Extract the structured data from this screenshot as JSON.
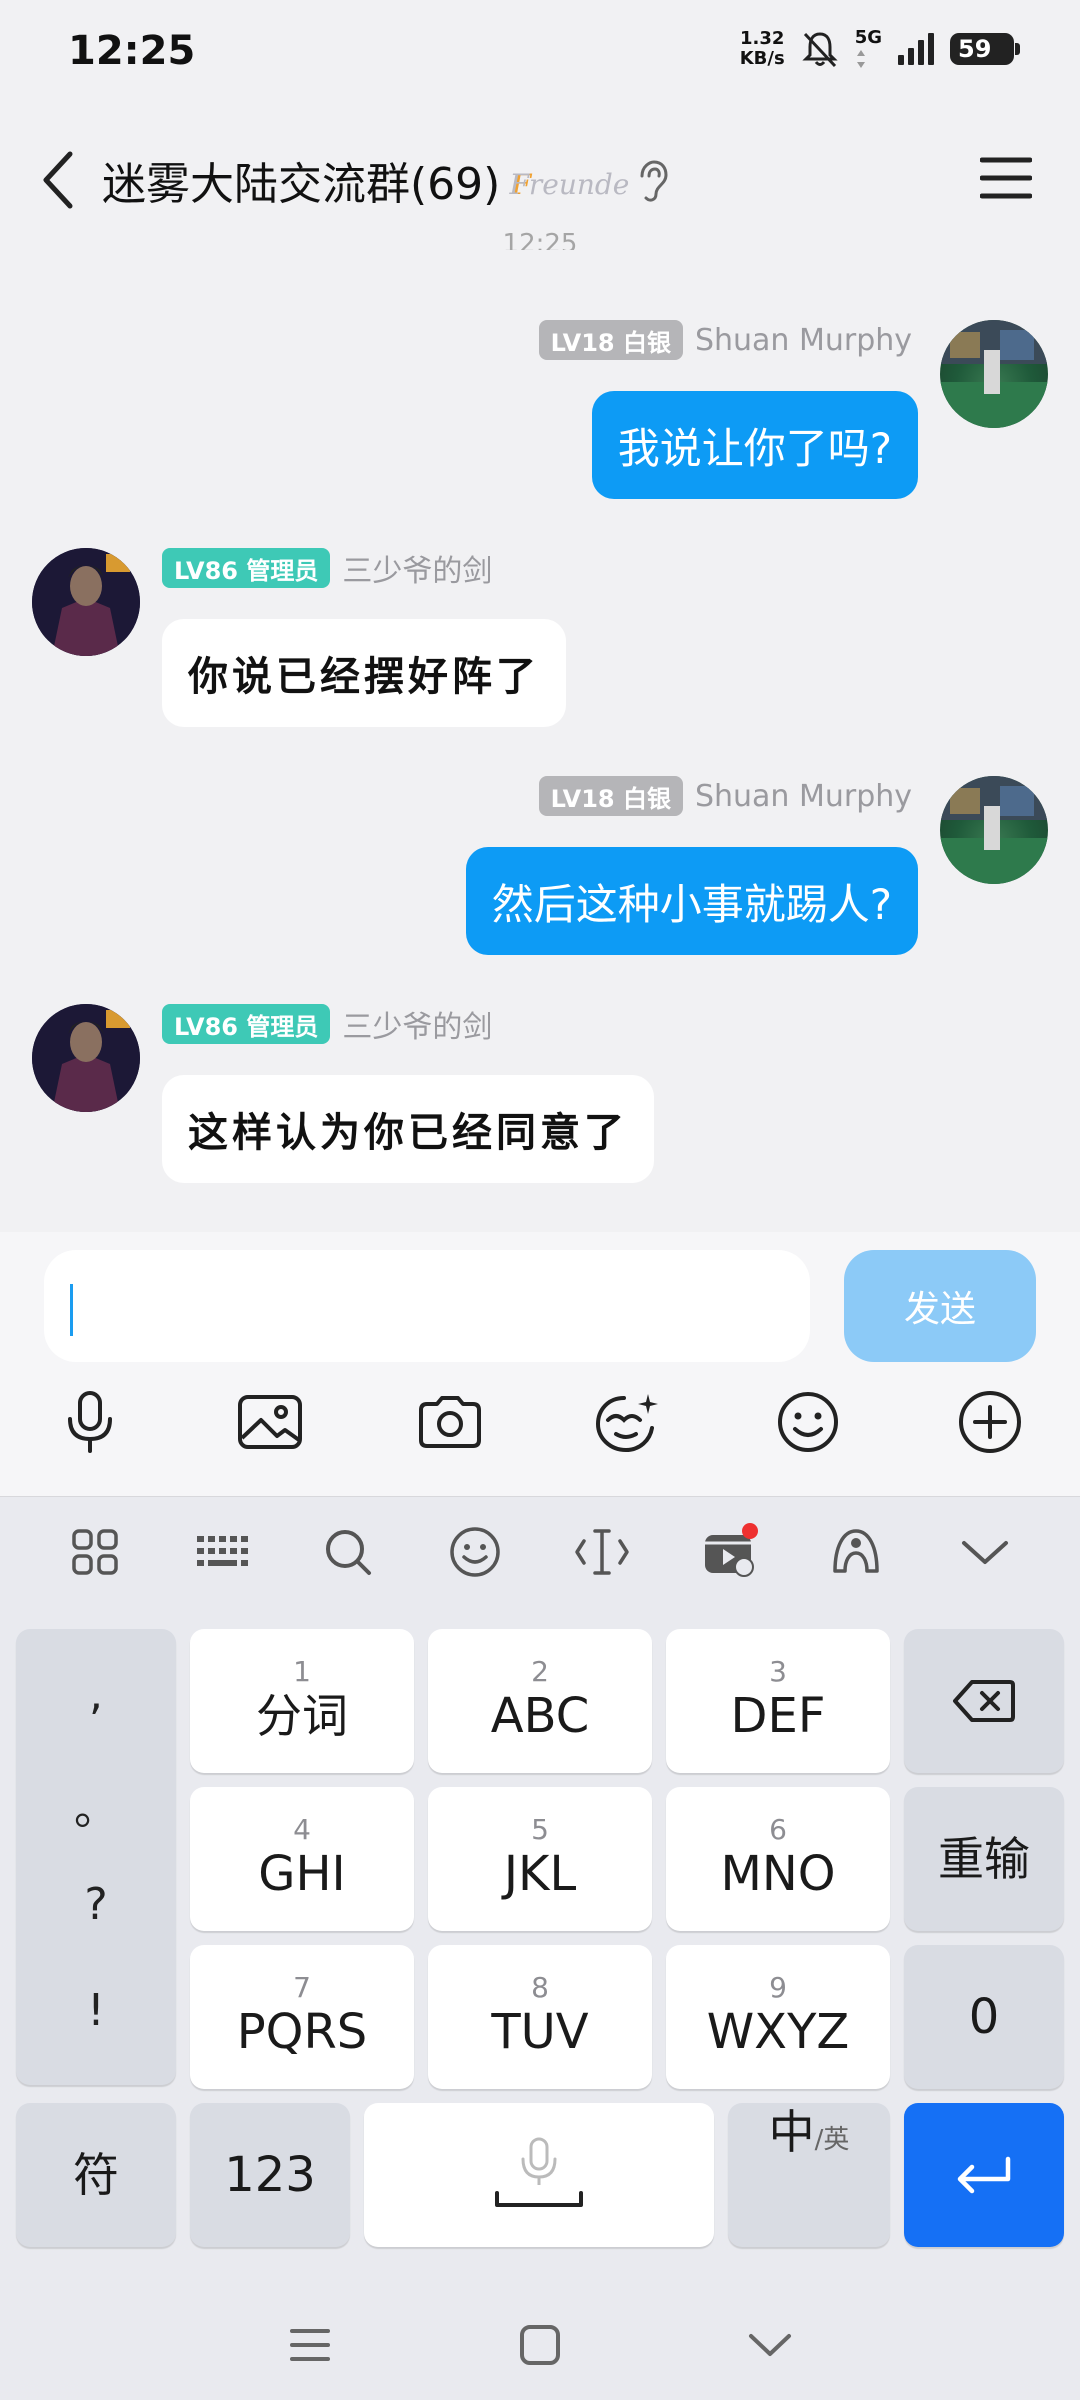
{
  "status_bar": {
    "time": "12:25",
    "net_speed_value": "1.32",
    "net_speed_unit": "KB/s",
    "network": "5G",
    "battery": "59",
    "icons": [
      "mute-notifications-icon",
      "signal-icon",
      "battery-icon"
    ]
  },
  "header": {
    "title": "迷雾大陆交流群(69)",
    "logo_text": "Freunde",
    "icons": [
      "back-arrow-icon",
      "ear-icon",
      "menu-icon"
    ]
  },
  "timestamp_partial": "12:25",
  "messages": [
    {
      "direction": "out",
      "level": "LV18 白银",
      "sender": "Shuan Murphy",
      "text": "我说让你了吗?"
    },
    {
      "direction": "in",
      "level": "LV86 管理员",
      "sender": "三少爷的剑",
      "text": "你说已经摆好阵了"
    },
    {
      "direction": "out",
      "level": "LV18 白银",
      "sender": "Shuan Murphy",
      "text": "然后这种小事就踢人?"
    },
    {
      "direction": "in",
      "level": "LV86 管理员",
      "sender": "三少爷的剑",
      "text": "这样认为你已经同意了"
    }
  ],
  "composer": {
    "input_value": "",
    "send_label": "发送",
    "tools": [
      "microphone-icon",
      "image-icon",
      "camera-icon",
      "sticker-icon",
      "emoji-icon",
      "plus-icon"
    ]
  },
  "keyboard": {
    "toolbar": [
      "grid-icon",
      "keyboard-icon",
      "search-icon",
      "emoji-icon",
      "cursor-icon",
      "video-clip-icon",
      "skin-icon",
      "collapse-icon"
    ],
    "punctuation": [
      ",",
      "。",
      "?",
      "!"
    ],
    "keys": [
      {
        "num": "1",
        "label": "分词"
      },
      {
        "num": "2",
        "label": "ABC"
      },
      {
        "num": "3",
        "label": "DEF"
      },
      {
        "num": "4",
        "label": "GHI"
      },
      {
        "num": "5",
        "label": "JKL"
      },
      {
        "num": "6",
        "label": "MNO"
      },
      {
        "num": "7",
        "label": "PQRS"
      },
      {
        "num": "8",
        "label": "TUV"
      },
      {
        "num": "9",
        "label": "WXYZ"
      }
    ],
    "reinput_label": "重输",
    "zero_label": "0",
    "symbols_label": "符",
    "numbers_label": "123",
    "lang_main": "中",
    "lang_sub": "/英"
  },
  "nav_icons": [
    "recent-apps-icon",
    "home-icon",
    "back-icon"
  ],
  "colors": {
    "outgoing_bubble": "#0d9bf5",
    "admin_badge": "#3ec9b6",
    "silver_badge": "#b5b5b8",
    "send_button": "#8ccaf7",
    "enter_key": "#1570f5"
  }
}
